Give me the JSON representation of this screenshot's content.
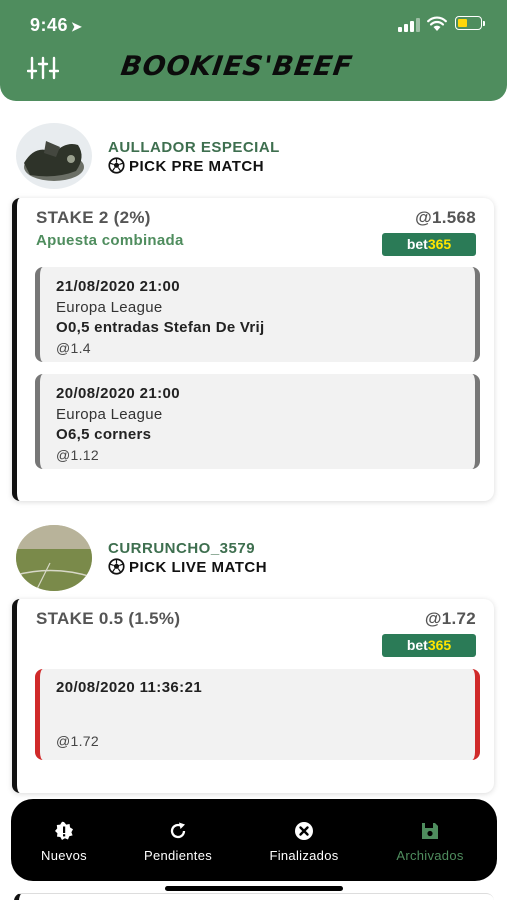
{
  "status_bar": {
    "time": "9:46"
  },
  "header": {
    "logo_text": "BOOKIES'BEEF"
  },
  "picks": [
    {
      "tipster": "AULLADOR ESPECIAL",
      "pick_type": "PICK PRE MATCH",
      "stake": "STAKE 2 (2%)",
      "odds": "@1.568",
      "bet_type": "Apuesta combinada",
      "bookie": {
        "a": "bet",
        "b": "365"
      },
      "selections": [
        {
          "date": "21/08/2020 21:00",
          "league": "Europa League",
          "market": "O0,5 entradas Stefan De Vrij",
          "odds": "@1.4"
        },
        {
          "date": "20/08/2020 21:00",
          "league": "Europa League",
          "market": "O6,5 corners",
          "odds": "@1.12"
        }
      ]
    },
    {
      "tipster": "CURRUNCHO_3579",
      "pick_type": "PICK LIVE MATCH",
      "stake": "STAKE 0.5 (1.5%)",
      "odds": "@1.72",
      "bookie": {
        "a": "bet",
        "b": "365"
      },
      "selections": [
        {
          "date": "20/08/2020 11:36:21",
          "odds": "@1.72"
        }
      ]
    }
  ],
  "tabs": [
    {
      "label": "Nuevos",
      "icon": "alert-badge-icon"
    },
    {
      "label": "Pendientes",
      "icon": "refresh-icon"
    },
    {
      "label": "Finalizados",
      "icon": "close-circle-icon"
    },
    {
      "label": "Archivados",
      "icon": "save-icon",
      "active": true
    }
  ],
  "colors": {
    "brand_green": "#4f8d5e",
    "lost_red": "#d02a2a",
    "bookie_green": "#2b7b57",
    "bookie_yellow": "#ffe500"
  }
}
